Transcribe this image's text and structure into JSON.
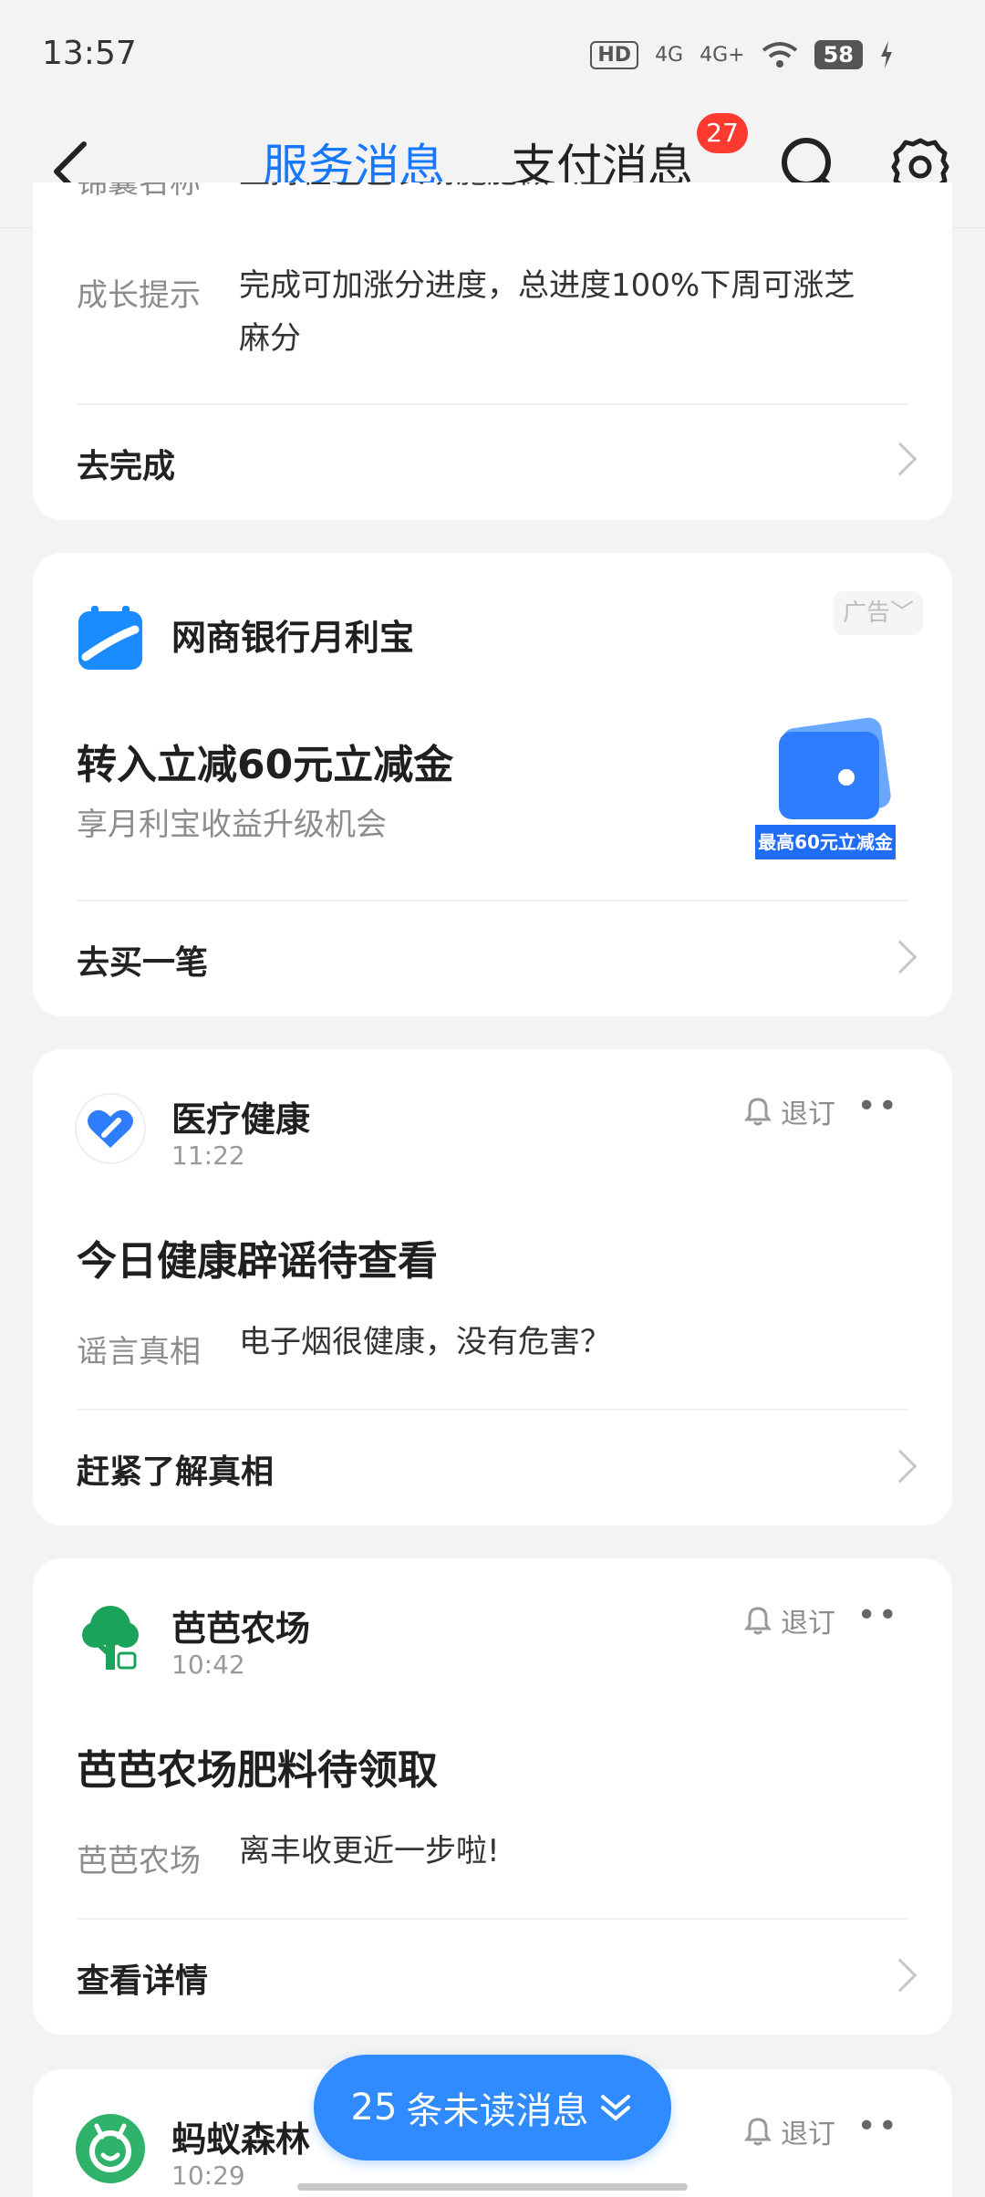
{
  "status": {
    "time": "13:57",
    "hd": "HD",
    "net1": "4G",
    "net2": "4G+",
    "battery": "58"
  },
  "nav": {
    "tab_service": "服务消息",
    "tab_payment": "支付消息",
    "payment_badge": "27"
  },
  "card1": {
    "partial_label": "锦囊名称",
    "partial_text": "坚持在芭芭农场施肥做公益",
    "label": "成长提示",
    "text_line1": "完成可加涨分进度，总进度100%下周可涨芝",
    "text_line2": "麻分",
    "action": "去完成"
  },
  "card2": {
    "app_name": "网商银行月利宝",
    "ad_tag": "广告",
    "title": "转入立减60元立减金",
    "subtitle": "享月利宝收益升级机会",
    "banner": "最高60元立减金",
    "action": "去买一笔"
  },
  "card3": {
    "app_name": "医疗健康",
    "time": "11:22",
    "unsubscribe": "退订",
    "title": "今日健康辟谣待查看",
    "label": "谣言真相",
    "text": "电子烟很健康，没有危害？",
    "action": "赶紧了解真相"
  },
  "card4": {
    "app_name": "芭芭农场",
    "time": "10:42",
    "unsubscribe": "退订",
    "title": "芭芭农场肥料待领取",
    "label": "芭芭农场",
    "text": "离丰收更近一步啦!",
    "action": "查看详情"
  },
  "card5": {
    "app_name": "蚂蚁森林",
    "time": "10:29",
    "unsubscribe": "退订"
  },
  "float": {
    "count": "25",
    "label": "条未读消息"
  },
  "colors": {
    "accent": "#1677ff",
    "badge": "#ff3a2f",
    "pill": "#2f8bff",
    "farm_green": "#1aa35a"
  }
}
